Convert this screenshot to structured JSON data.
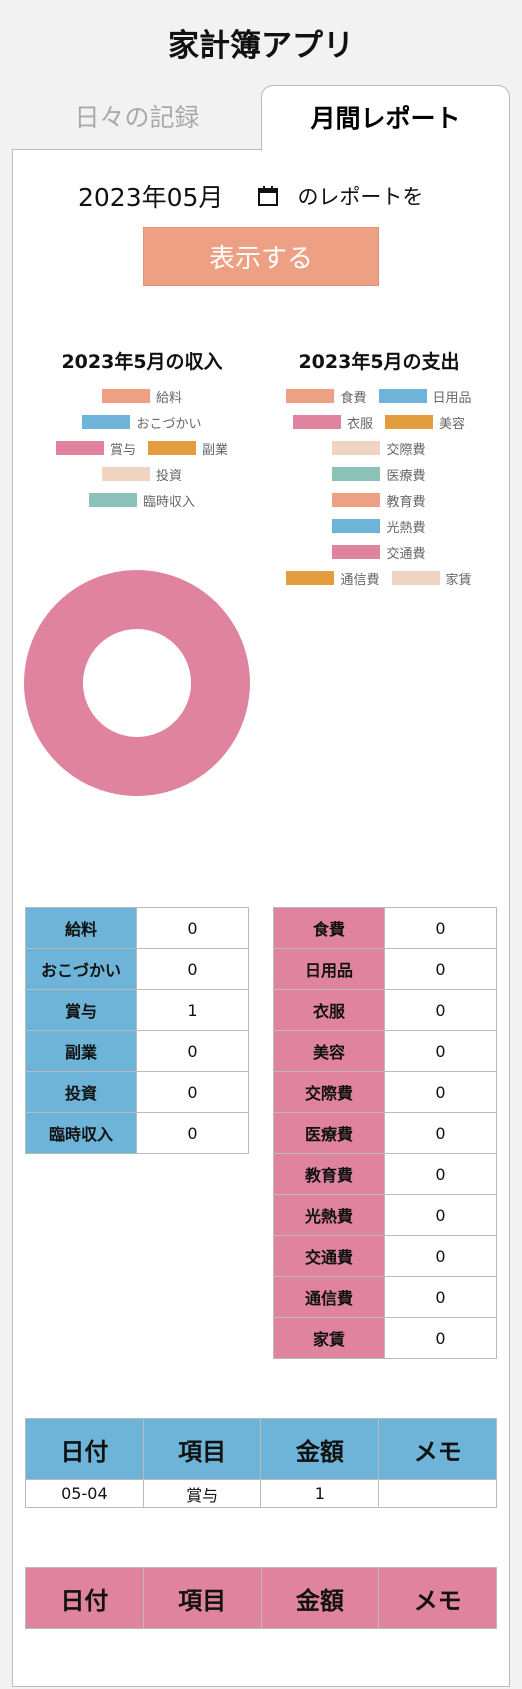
{
  "app": {
    "title": "家計簿アプリ"
  },
  "tabs": [
    {
      "label": "日々の記録",
      "active": false
    },
    {
      "label": "月間レポート",
      "active": true
    }
  ],
  "report": {
    "month_value": "2023年05月",
    "month_suffix": "のレポートを",
    "show_button": "表示する"
  },
  "colors": {
    "salmon": "#eea085",
    "blue": "#6db4d8",
    "pink": "#df839f",
    "orange": "#e49d3e",
    "peach": "#f0d3c1",
    "teal": "#8cc1b8"
  },
  "income_chart": {
    "title": "2023年5月の収入",
    "legend": [
      {
        "label": "給料",
        "color": "#eea085"
      },
      {
        "label": "おこづかい",
        "color": "#6db4d8"
      },
      {
        "label": "賞与",
        "color": "#df839f"
      },
      {
        "label": "副業",
        "color": "#e49d3e"
      },
      {
        "label": "投資",
        "color": "#f0d3c1"
      },
      {
        "label": "臨時収入",
        "color": "#8cc1b8"
      }
    ]
  },
  "expense_chart": {
    "title": "2023年5月の支出",
    "legend": [
      {
        "label": "食費",
        "color": "#eea085"
      },
      {
        "label": "日用品",
        "color": "#6db4d8"
      },
      {
        "label": "衣服",
        "color": "#df839f"
      },
      {
        "label": "美容",
        "color": "#e49d3e"
      },
      {
        "label": "交際費",
        "color": "#f0d3c1"
      },
      {
        "label": "医療費",
        "color": "#8cc1b8"
      },
      {
        "label": "教育費",
        "color": "#eea085"
      },
      {
        "label": "光熱費",
        "color": "#6db4d8"
      },
      {
        "label": "交通費",
        "color": "#df839f"
      },
      {
        "label": "通信費",
        "color": "#e49d3e"
      },
      {
        "label": "家賃",
        "color": "#f0d3c1"
      }
    ]
  },
  "chart_data": {
    "type": "pie",
    "title": "2023年5月の収入",
    "categories": [
      "給料",
      "おこづかい",
      "賞与",
      "副業",
      "投資",
      "臨時収入"
    ],
    "values": [
      0,
      0,
      1,
      0,
      0,
      0
    ]
  },
  "income_totals": [
    {
      "label": "給料",
      "value": "0"
    },
    {
      "label": "おこづかい",
      "value": "0"
    },
    {
      "label": "賞与",
      "value": "1"
    },
    {
      "label": "副業",
      "value": "0"
    },
    {
      "label": "投資",
      "value": "0"
    },
    {
      "label": "臨時収入",
      "value": "0"
    }
  ],
  "expense_totals": [
    {
      "label": "食費",
      "value": "0"
    },
    {
      "label": "日用品",
      "value": "0"
    },
    {
      "label": "衣服",
      "value": "0"
    },
    {
      "label": "美容",
      "value": "0"
    },
    {
      "label": "交際費",
      "value": "0"
    },
    {
      "label": "医療費",
      "value": "0"
    },
    {
      "label": "教育費",
      "value": "0"
    },
    {
      "label": "光熱費",
      "value": "0"
    },
    {
      "label": "交通費",
      "value": "0"
    },
    {
      "label": "通信費",
      "value": "0"
    },
    {
      "label": "家賃",
      "value": "0"
    }
  ],
  "income_records": {
    "headers": [
      "日付",
      "項目",
      "金額",
      "メモ"
    ],
    "rows": [
      [
        "05-04",
        "賞与",
        "1",
        ""
      ]
    ]
  },
  "expense_records": {
    "headers": [
      "日付",
      "項目",
      "金額",
      "メモ"
    ],
    "rows": []
  }
}
